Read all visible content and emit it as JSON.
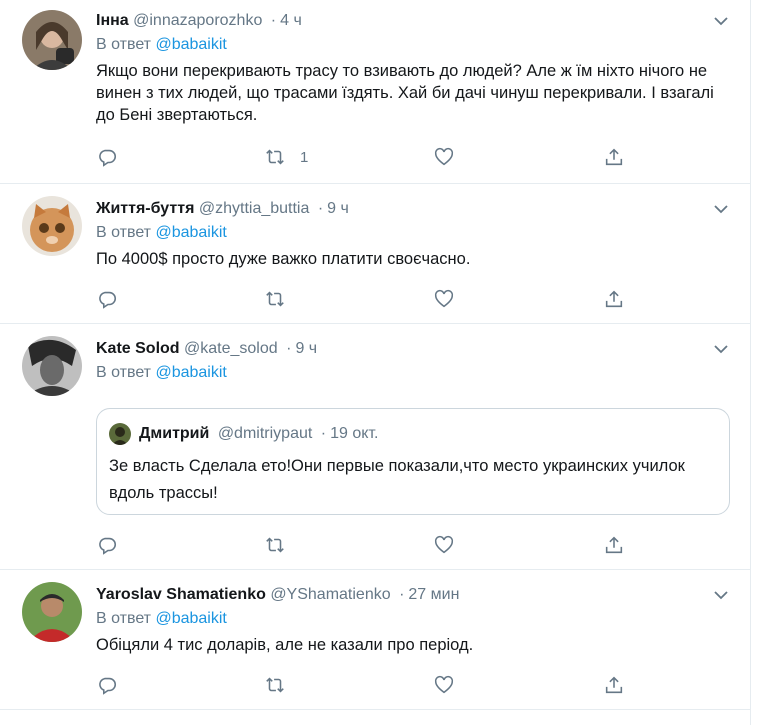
{
  "tweets": [
    {
      "name": "Інна",
      "handle": "@innazaporozhko",
      "separator": "·",
      "time": "4 ч",
      "reply_prefix": "В ответ ",
      "reply_to": "@babaikit",
      "text": "Якщо вони перекривають трасу то взивають до людей? Але ж їм ніхто нічого не винен з тих людей, що трасами їздять. Хай би дачі чинуш перекривали. І взагалі до Бені звертаються.",
      "retweets": "1",
      "avatar_color": "#6b5a4a"
    },
    {
      "name": "Життя-буття",
      "handle": "@zhyttia_buttia",
      "separator": "·",
      "time": "9 ч",
      "reply_prefix": "В ответ ",
      "reply_to": "@babaikit",
      "text": "По 4000$ просто дуже важко платити своєчасно.",
      "avatar_color": "#c88a52"
    },
    {
      "name": "Kate Solod",
      "handle": "@kate_solod",
      "separator": "·",
      "time": "9 ч",
      "reply_prefix": "В ответ ",
      "reply_to": "@babaikit",
      "avatar_color": "#555555",
      "quote": {
        "name": "Дмитрий",
        "handle": "@dmitriypaut",
        "separator": "·",
        "time": "19 окт.",
        "text": "Зе власть Сделала ето!Они первые показали,что место украинских училок вдоль трассы!"
      }
    },
    {
      "name": "Yaroslav Shamatienko",
      "handle": "@YShamatienko",
      "separator": "·",
      "time": "27 мин",
      "reply_prefix": "В ответ ",
      "reply_to": "@babaikit",
      "text": "Обіцяли 4 тис доларів, але не казали про період.",
      "avatar_color": "#4a7a3a"
    }
  ],
  "colors": {
    "link": "#1b95e0",
    "secondary_text": "#657786",
    "border": "#e6ecf0"
  },
  "icons": [
    "reply-icon",
    "retweet-icon",
    "like-icon",
    "share-icon",
    "chevron-down-icon"
  ]
}
